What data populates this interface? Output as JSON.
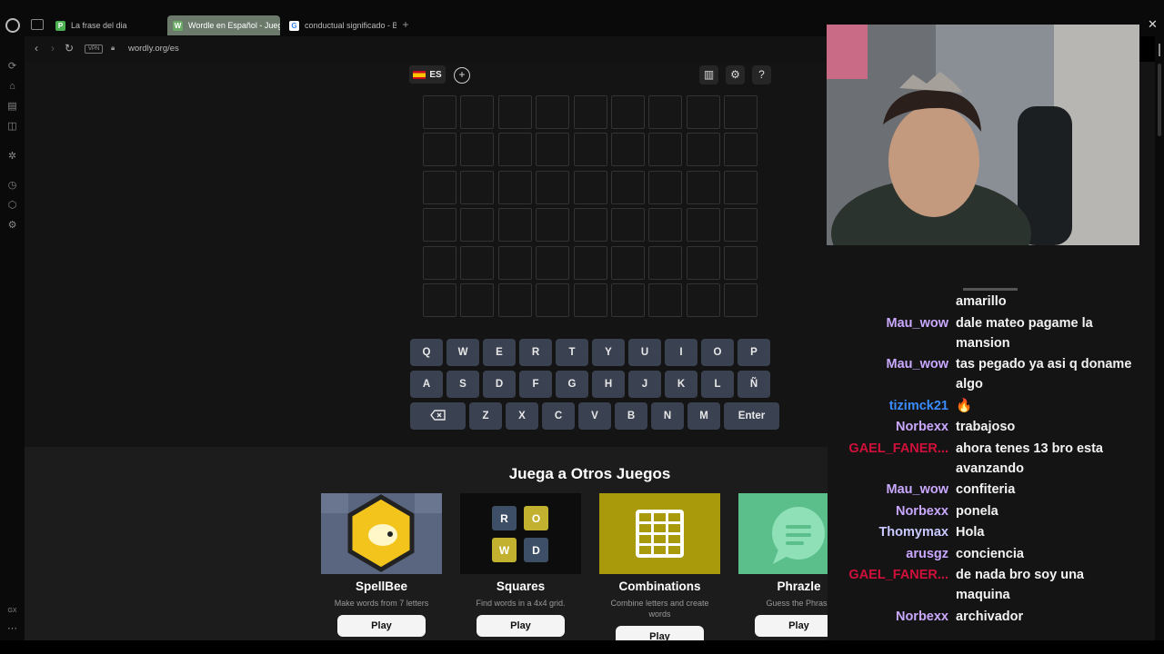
{
  "tabs": [
    {
      "label": "La frase del dia",
      "favicon": "P",
      "color": "#4caf50"
    },
    {
      "label": "Wordle en Español - Jueg",
      "favicon": "W",
      "color": "#6aaa64",
      "active": true
    },
    {
      "label": "conductual significado - B",
      "favicon": "G",
      "color": "#ffffff"
    }
  ],
  "address": {
    "vpn_label": "VPN",
    "url": "wordly.org/es"
  },
  "sidebar_bottom_label": "GX",
  "game": {
    "language_label": "ES",
    "grid_rows": 6,
    "grid_cols": 9,
    "keyboard": {
      "row1": [
        "Q",
        "W",
        "E",
        "R",
        "T",
        "Y",
        "U",
        "I",
        "O",
        "P"
      ],
      "row2": [
        "A",
        "S",
        "D",
        "F",
        "G",
        "H",
        "J",
        "K",
        "L",
        "Ñ"
      ],
      "row3": [
        "Z",
        "X",
        "C",
        "V",
        "B",
        "N",
        "M"
      ],
      "backspace_icon": "backspace-icon",
      "enter_label": "Enter"
    }
  },
  "other_games": {
    "title": "Juega a Otros Juegos",
    "cards": [
      {
        "name": "SpellBee",
        "desc": "Make words from 7 letters",
        "play": "Play"
      },
      {
        "name": "Squares",
        "desc": "Find words in a 4x4 grid.",
        "play": "Play",
        "tiles": [
          "R",
          "O",
          "W",
          "D"
        ]
      },
      {
        "name": "Combinations",
        "desc": "Combine letters and create words",
        "play": "Play"
      },
      {
        "name": "Phrazle",
        "desc": "Guess the Phrase",
        "play": "Play"
      }
    ]
  },
  "chat": [
    {
      "user": "",
      "text": "amarillo",
      "color": "#c9a8ff"
    },
    {
      "user": "Mau_wow",
      "text": "dale mateo pagame la mansion",
      "color": "#c9a8ff"
    },
    {
      "user": "Mau_wow",
      "text": "tas pegado ya asi q doname algo",
      "color": "#c9a8ff"
    },
    {
      "user": "tizimck21",
      "text": "🔥",
      "color": "#3a8cff"
    },
    {
      "user": "Norbexx",
      "text": "trabajoso",
      "color": "#c9a8ff"
    },
    {
      "user": "GAEL_FANER...",
      "text": "ahora tenes 13 bro esta avanzando",
      "color": "#d0103a"
    },
    {
      "user": "Mau_wow",
      "text": "confiteria",
      "color": "#c9a8ff"
    },
    {
      "user": "Norbexx",
      "text": "ponela",
      "color": "#c9a8ff"
    },
    {
      "user": "Thomymax",
      "text": "Hola",
      "color": "#c9c9ff"
    },
    {
      "user": "arusgz",
      "text": "conciencia",
      "color": "#c9a8ff"
    },
    {
      "user": "GAEL_FANER...",
      "text": "de nada bro soy una maquina",
      "color": "#d0103a"
    },
    {
      "user": "Norbexx",
      "text": "archivador",
      "color": "#c9a8ff"
    }
  ]
}
